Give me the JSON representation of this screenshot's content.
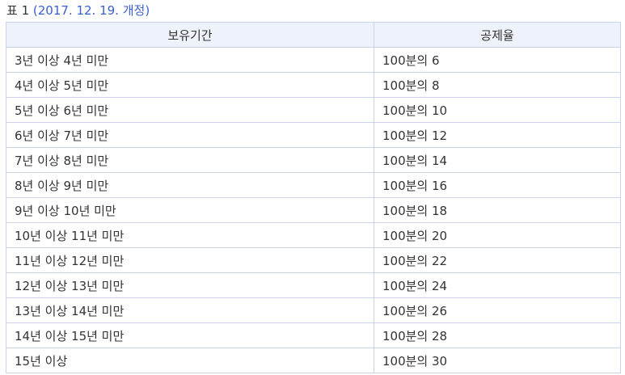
{
  "caption": {
    "prefix": "표 1 ",
    "open_paren": "(",
    "link_text": "2017. 12. 19. 개정",
    "close_paren": ")"
  },
  "table": {
    "headers": [
      "보유기간",
      "공제율"
    ],
    "rows": [
      [
        "3년 이상 4년 미만",
        "100분의 6"
      ],
      [
        "4년 이상 5년 미만",
        "100분의 8"
      ],
      [
        "5년 이상 6년 미만",
        "100분의 10"
      ],
      [
        "6년 이상 7년 미만",
        "100분의 12"
      ],
      [
        "7년 이상 8년 미만",
        "100분의 14"
      ],
      [
        "8년 이상 9년 미만",
        "100분의 16"
      ],
      [
        "9년 이상 10년 미만",
        "100분의 18"
      ],
      [
        "10년 이상 11년 미만",
        "100분의 20"
      ],
      [
        "11년 이상 12년 미만",
        "100분의 22"
      ],
      [
        "12년 이상 13년 미만",
        "100분의 24"
      ],
      [
        "13년 이상 14년 미만",
        "100분의 26"
      ],
      [
        "14년 이상 15년 미만",
        "100분의 28"
      ],
      [
        "15년 이상",
        "100분의 30"
      ]
    ]
  }
}
